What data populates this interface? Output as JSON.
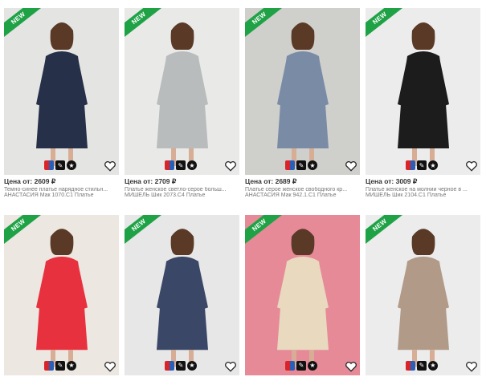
{
  "badge_new": "NEW",
  "products": [
    {
      "price": "Цена от: 2609 ₽",
      "title": "Темно-синее платье нарядное стильн...",
      "meta": "АНАСТАСИЯ Мак 1070.С1 Платье",
      "dress_color": "#263048",
      "bg_color": "#e4e4e2"
    },
    {
      "price": "Цена от: 2709 ₽",
      "title": "Платье женское светло-серое больш...",
      "meta": "МИШЕЛЬ Шик 2073.С4 Платье",
      "dress_color": "#b9bcbc",
      "bg_color": "#e9e9e8"
    },
    {
      "price": "Цена от: 2689 ₽",
      "title": "Платье серое женское свободного кр...",
      "meta": "АНАСТАСИЯ Мак 942.1.С1 Платье",
      "dress_color": "#7a8ba6",
      "bg_color": "#cfcfcc"
    },
    {
      "price": "Цена от: 3009 ₽",
      "title": "Платье женское на молнии черное в ...",
      "meta": "МИШЕЛЬ Шик 2104.С1 Платье",
      "dress_color": "#1c1c1c",
      "bg_color": "#ececec"
    },
    {
      "price": "",
      "title": "",
      "meta": "",
      "dress_color": "#e8313e",
      "bg_color": "#ece7e1"
    },
    {
      "price": "",
      "title": "",
      "meta": "",
      "dress_color": "#3a4766",
      "bg_color": "#e7e7e7"
    },
    {
      "price": "",
      "title": "",
      "meta": "",
      "dress_color": "#e8d9bf",
      "bg_color": "#e68a98"
    },
    {
      "price": "",
      "title": "",
      "meta": "",
      "dress_color": "#b29a88",
      "bg_color": "#ececec"
    }
  ],
  "icons": {
    "size_badge": "size-chart-icon",
    "pencil_badge": "pencil-icon",
    "star_badge": "star-icon",
    "favorite": "heart-icon"
  }
}
